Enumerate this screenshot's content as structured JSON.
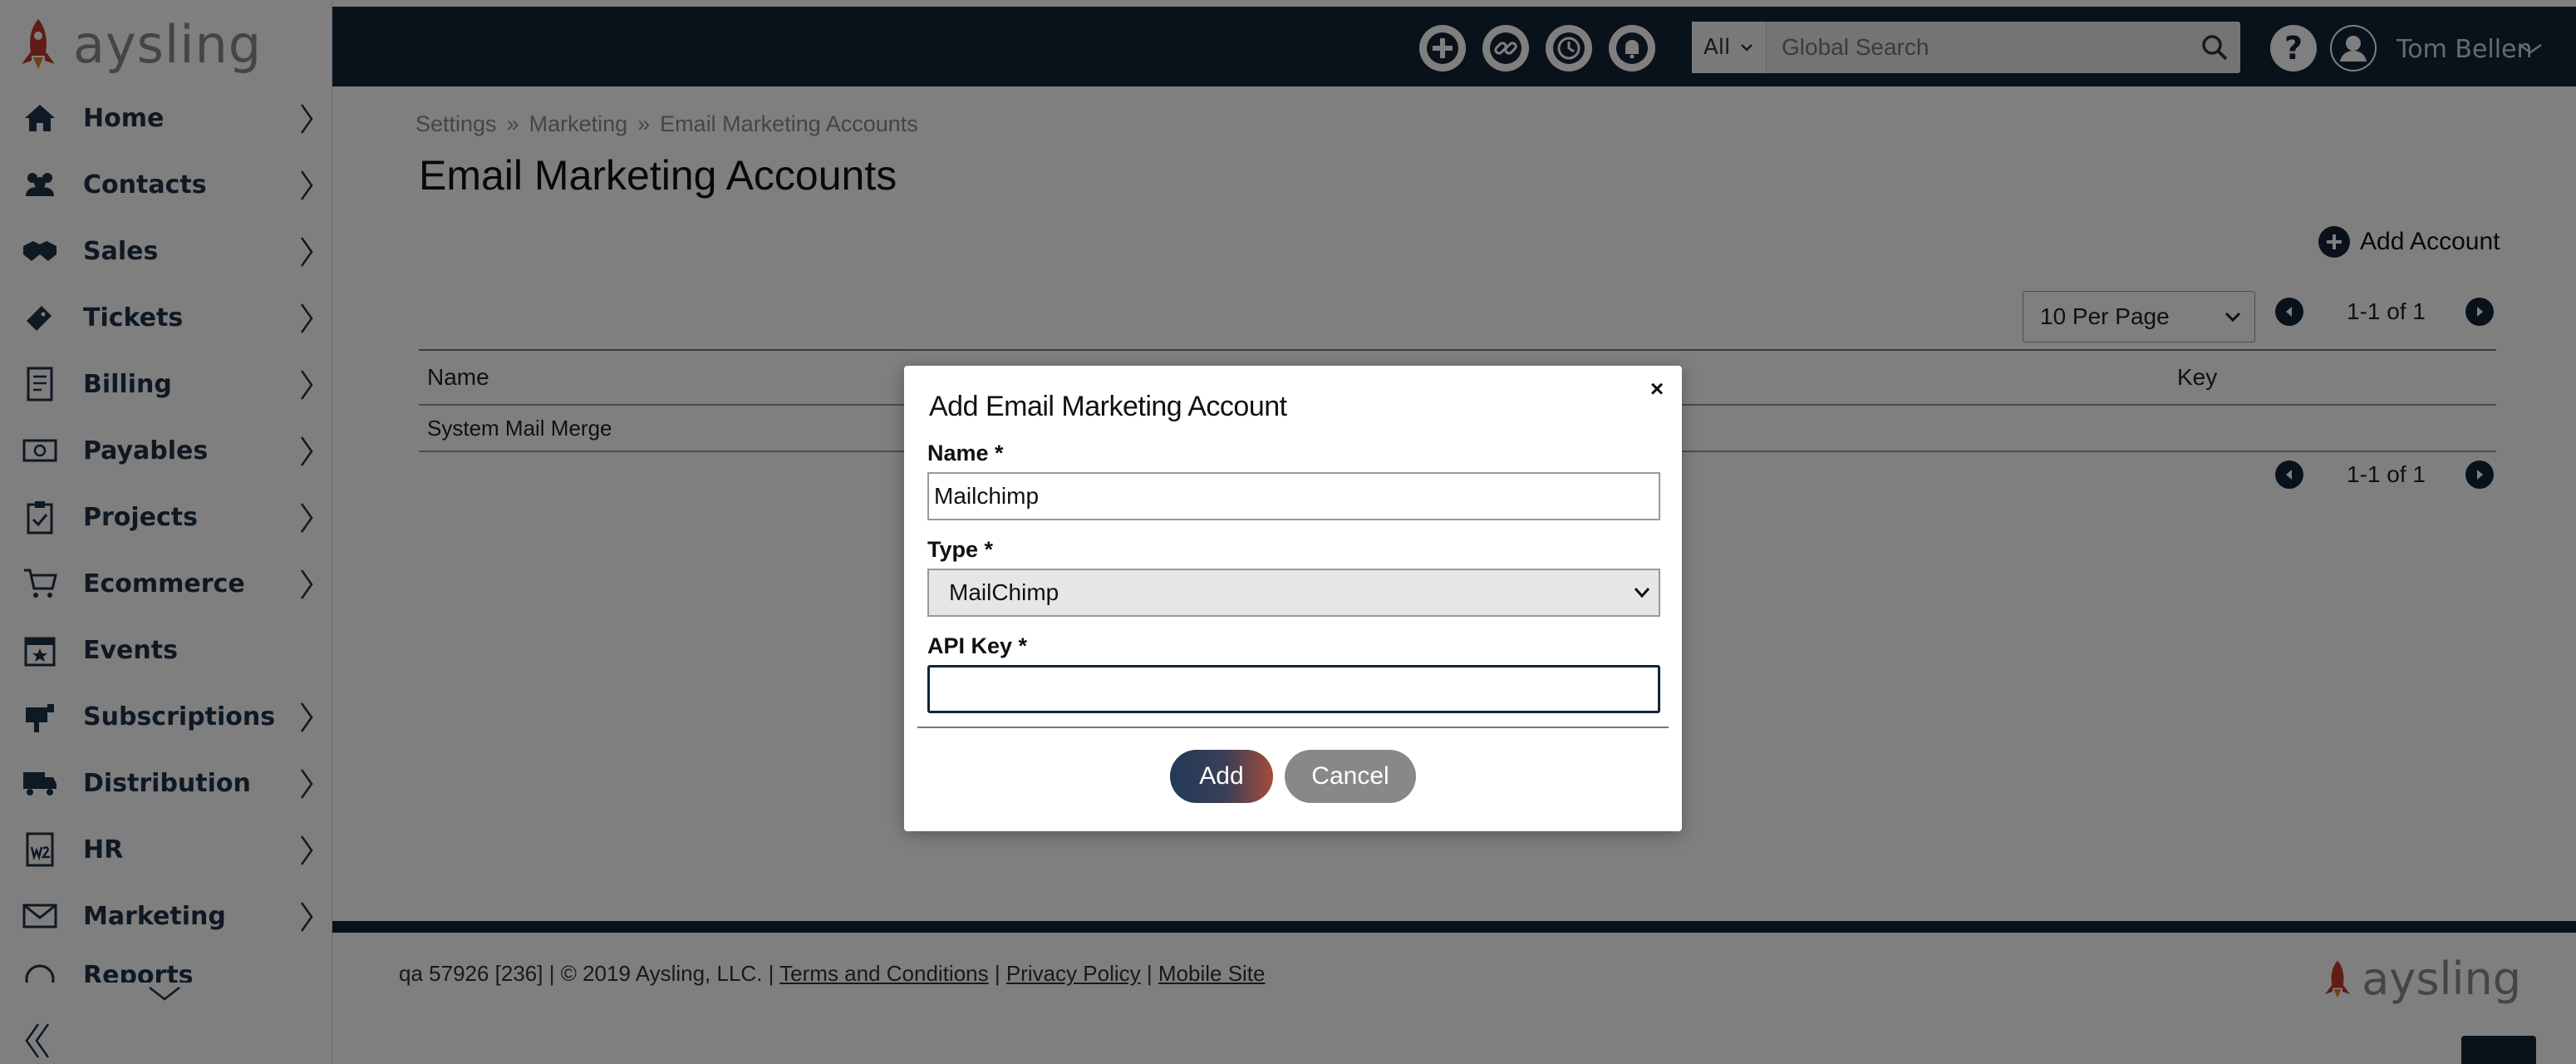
{
  "app": {
    "logo_text": "aysling"
  },
  "sidebar": {
    "items": [
      {
        "label": "Home",
        "icon": "home-icon",
        "has_children": true
      },
      {
        "label": "Contacts",
        "icon": "contacts-icon",
        "has_children": true
      },
      {
        "label": "Sales",
        "icon": "handshake-icon",
        "has_children": true
      },
      {
        "label": "Tickets",
        "icon": "ticket-icon",
        "has_children": true
      },
      {
        "label": "Billing",
        "icon": "invoice-icon",
        "has_children": true
      },
      {
        "label": "Payables",
        "icon": "money-icon",
        "has_children": true
      },
      {
        "label": "Projects",
        "icon": "clipboard-icon",
        "has_children": true
      },
      {
        "label": "Ecommerce",
        "icon": "cart-icon",
        "has_children": true
      },
      {
        "label": "Events",
        "icon": "calendar-star-icon",
        "has_children": false
      },
      {
        "label": "Subscriptions",
        "icon": "mailbox-icon",
        "has_children": true
      },
      {
        "label": "Distribution",
        "icon": "truck-icon",
        "has_children": true
      },
      {
        "label": "HR",
        "icon": "w2-form-icon",
        "has_children": true
      },
      {
        "label": "Marketing",
        "icon": "envelope-icon",
        "has_children": true
      },
      {
        "label": "Reports",
        "icon": "reports-icon",
        "has_children": true
      }
    ]
  },
  "topbar": {
    "search_scope": "All",
    "search_placeholder": "Global Search",
    "help_label": "?",
    "user_name": "Tom Bellen"
  },
  "main": {
    "breadcrumb": [
      "Settings",
      "Marketing",
      "Email Marketing Accounts"
    ],
    "breadcrumb_sep": "»",
    "page_title": "Email Marketing Accounts",
    "add_account_label": "Add Account",
    "per_page": "10 Per Page",
    "pagination_text": "1-1 of 1",
    "table": {
      "columns": [
        "Name",
        "Key"
      ],
      "rows": [
        {
          "name": "System Mail Merge",
          "key": ""
        }
      ]
    }
  },
  "footer": {
    "build": "qa 57926 [236]",
    "copyright": "© 2019 Aysling, LLC.",
    "links": [
      "Terms and Conditions",
      "Privacy Policy",
      "Mobile Site"
    ],
    "logo_text": "aysling"
  },
  "modal": {
    "title": "Add Email Marketing Account",
    "close_label": "×",
    "fields": {
      "name": {
        "label": "Name *",
        "value": "Mailchimp"
      },
      "type": {
        "label": "Type *",
        "value": "MailChimp"
      },
      "api_key": {
        "label": "API Key *",
        "value": ""
      }
    },
    "add_label": "Add",
    "cancel_label": "Cancel"
  },
  "colors": {
    "navy": "#122536",
    "brand_red": "#c0392b",
    "overlay": "rgba(0,0,0,0.5)"
  }
}
